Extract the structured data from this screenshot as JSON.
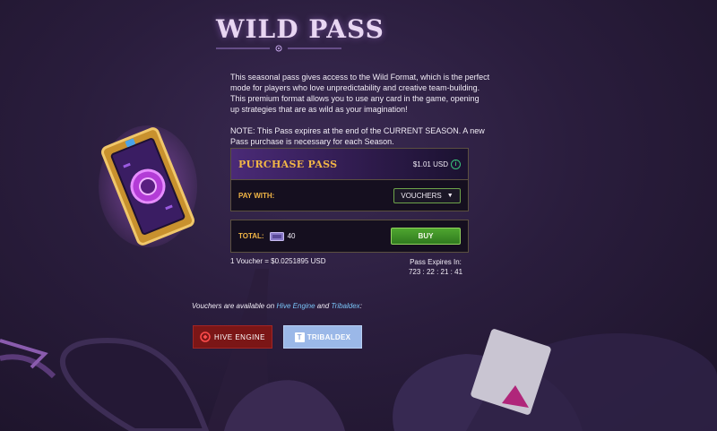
{
  "page": {
    "title": "WILD PASS"
  },
  "description": {
    "paragraph1": "This seasonal pass gives access to the Wild Format, which is the perfect mode for players who love unpredictability and creative team-building. This premium format allows you to use any card in the game, opening up strategies that are as wild as your imagination!",
    "paragraph2": "NOTE: This Pass expires at the end of the CURRENT SEASON. A new Pass purchase is necessary for each Season."
  },
  "purchase": {
    "title": "PURCHASE PASS",
    "price": "$1.01 USD",
    "pay_with_label": "PAY WITH:",
    "payment_method": "VOUCHERS"
  },
  "total": {
    "label": "TOTAL:",
    "amount": "40",
    "buy_label": "BUY"
  },
  "rate_text": "1 Voucher = $0.0251895 USD",
  "expires": {
    "label": "Pass Expires In:",
    "countdown": "723 : 22 : 21 : 41"
  },
  "vouchers_note": {
    "prefix": "Vouchers are available on ",
    "hive_link": "Hive Engine",
    "joiner": " and ",
    "tribaldex_link": "Tribaldex",
    "suffix": ":"
  },
  "buttons": {
    "hive_label": "HIVE ENGINE",
    "tribal_label": "TRIBALDEX"
  },
  "colors": {
    "accent_gold": "#f2b646",
    "buy_green": "#3e8f27",
    "hive_red": "#7b1616",
    "tribaldex_blue": "#9bb8e8",
    "link_blue": "#79c4f7"
  },
  "icons": [
    "info-icon",
    "chevron-down-icon",
    "voucher-icon",
    "hive-engine-logo-icon",
    "tribaldex-logo-icon",
    "pass-ticket-image"
  ]
}
